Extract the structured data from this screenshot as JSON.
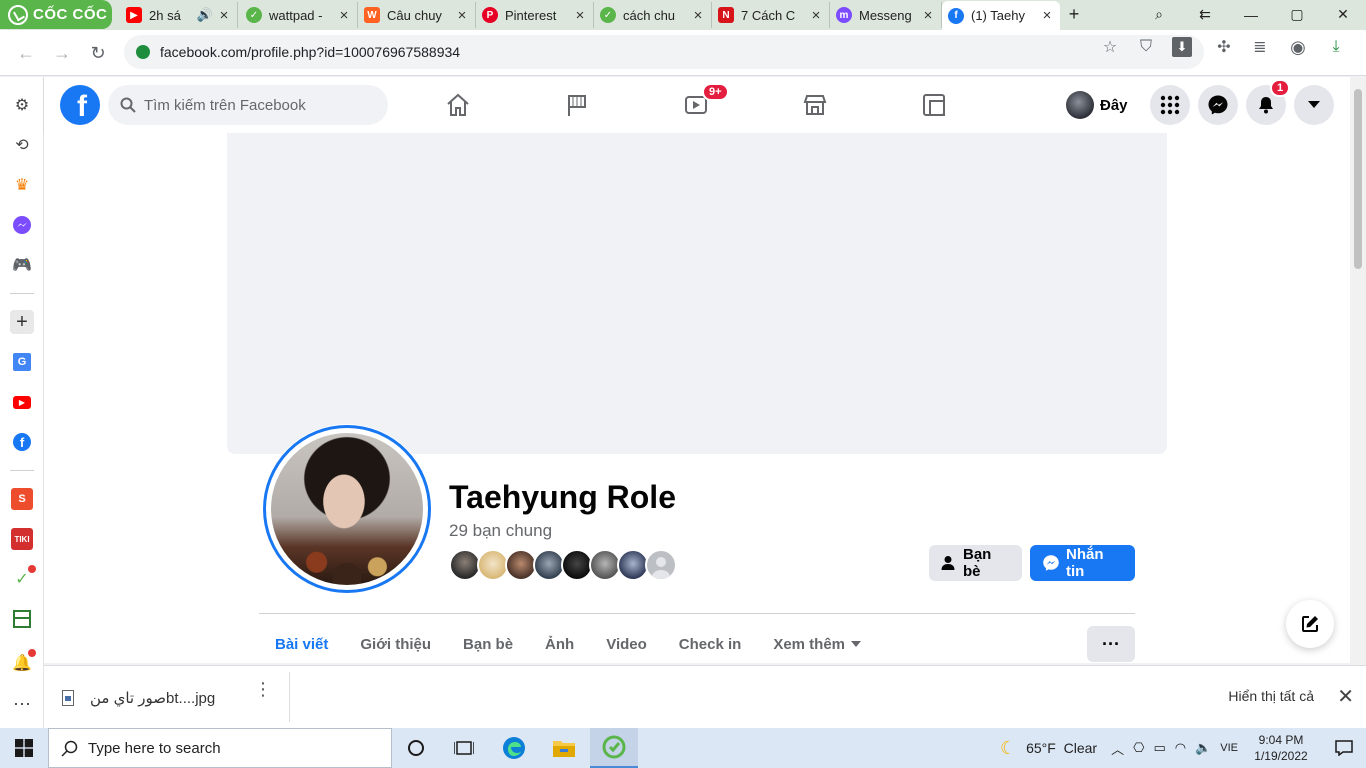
{
  "browser": {
    "brand": "CỐC CỐC",
    "tabs": [
      {
        "title": "2h sá",
        "fav_color": "#ff0000",
        "fav_char": "▶"
      },
      {
        "title": "wattpad -",
        "fav_color": "#5ab54a",
        "fav_char": "✓"
      },
      {
        "title": "Câu chuy",
        "fav_color": "#ff6122",
        "fav_char": "W"
      },
      {
        "title": "Pinterest",
        "fav_color": "#e60023",
        "fav_char": "P"
      },
      {
        "title": "cách chu",
        "fav_color": "#5ab54a",
        "fav_char": "✓"
      },
      {
        "title": "7 Cách C",
        "fav_color": "#d7141a",
        "fav_char": "N"
      },
      {
        "title": "Messeng",
        "fav_color": "#7b4dff",
        "fav_char": "m"
      },
      {
        "title": "(1) Taehy",
        "fav_color": "#1877f2",
        "fav_char": "f"
      }
    ],
    "new_tab": "+",
    "url": "facebook.com/profile.php?id=100076967588934"
  },
  "facebook": {
    "logo": "f",
    "search_placeholder": "Tìm kiếm trên Facebook",
    "watch_badge": "9+",
    "notif_badge": "1",
    "profile_chip": "Đây",
    "profile": {
      "name": "Taehyung Role",
      "mutual_friends": "29 bạn chung",
      "mutual_avatar_colors": [
        "#3a3a3a",
        "#e8d9b8",
        "#6b4a3a",
        "#4a5a6a",
        "#1a1a1a",
        "#7a7a7a",
        "#5a6a8a",
        "#bcc0c4"
      ]
    },
    "buttons": {
      "friends": "Bạn bè",
      "message": "Nhắn tin",
      "more": "···"
    },
    "tabs": [
      {
        "label": "Bài viết",
        "active": true
      },
      {
        "label": "Giới thiệu",
        "active": false
      },
      {
        "label": "Bạn bè",
        "active": false
      },
      {
        "label": "Ảnh",
        "active": false
      },
      {
        "label": "Video",
        "active": false
      },
      {
        "label": "Check in",
        "active": false
      },
      {
        "label": "Xem thêm",
        "active": false
      }
    ]
  },
  "downloads": {
    "file_name": "صور تاي منbt....jpg",
    "show_all": "Hiển thị tất cả"
  },
  "taskbar": {
    "search_placeholder": "Type here to search",
    "weather": "65°F  Clear",
    "lang": "VIE",
    "time": "9:04 PM",
    "date": "1/19/2022"
  },
  "colors": {
    "fb_blue": "#1877f2",
    "coccoc_green": "#5ab54a",
    "badge_red": "#e41e3f"
  }
}
